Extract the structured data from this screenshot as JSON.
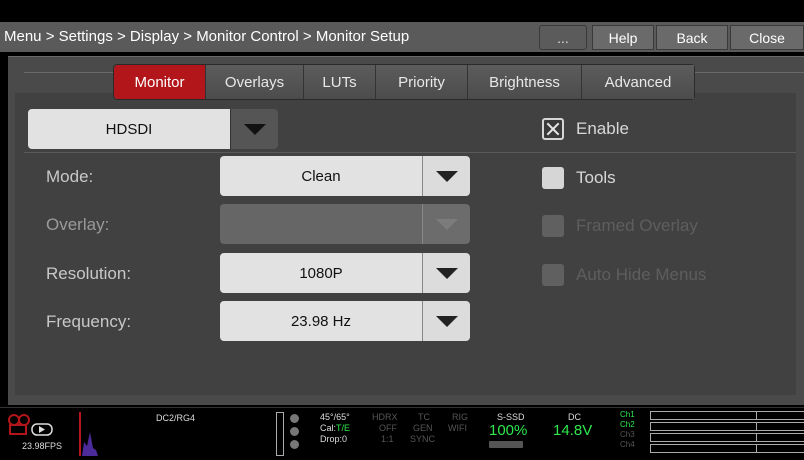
{
  "breadcrumb": "Menu > Settings > Display > Monitor Control > Monitor Setup",
  "toolbar": {
    "more": "...",
    "help": "Help",
    "back": "Back",
    "close": "Close"
  },
  "tabs": [
    "Monitor",
    "Overlays",
    "LUTs",
    "Priority",
    "Brightness",
    "Advanced"
  ],
  "active_tab": "Monitor",
  "output_select": {
    "value": "HDSDI"
  },
  "fields": {
    "mode": {
      "label": "Mode:",
      "value": "Clean"
    },
    "overlay": {
      "label": "Overlay:",
      "value": "",
      "disabled": true
    },
    "resolution": {
      "label": "Resolution:",
      "value": "1080P"
    },
    "frequency": {
      "label": "Frequency:",
      "value": "23.98 Hz"
    }
  },
  "checkboxes": {
    "enable": {
      "label": "Enable",
      "checked": true
    },
    "tools": {
      "label": "Tools",
      "checked": false
    },
    "framed_overlay": {
      "label": "Framed Overlay",
      "checked": false,
      "disabled": true
    },
    "auto_hide_menus": {
      "label": "Auto Hide Menus",
      "checked": false,
      "disabled": true
    }
  },
  "status_bar": {
    "fps": "23.98FPS",
    "color": "DC2/RG4",
    "temp": "45°/65°",
    "cal": "Cal:",
    "cal_value": "T/E",
    "drop": "Drop:0",
    "hdrx": "HDRX",
    "hdrx_value": "OFF",
    "hdrx_ratio": "1:1",
    "tc": "TC",
    "tc_value": "GEN",
    "tc_sync": "SYNC",
    "rig": "RIG",
    "rig_value": "WIFI",
    "media_label": "S-SSD",
    "media_value": "100%",
    "power_label": "DC",
    "power_value": "14.8V",
    "channels": [
      "Ch1",
      "Ch2",
      "Ch3",
      "Ch4"
    ],
    "accent_color": "#2ee84d",
    "record_color": "#b3161a"
  }
}
